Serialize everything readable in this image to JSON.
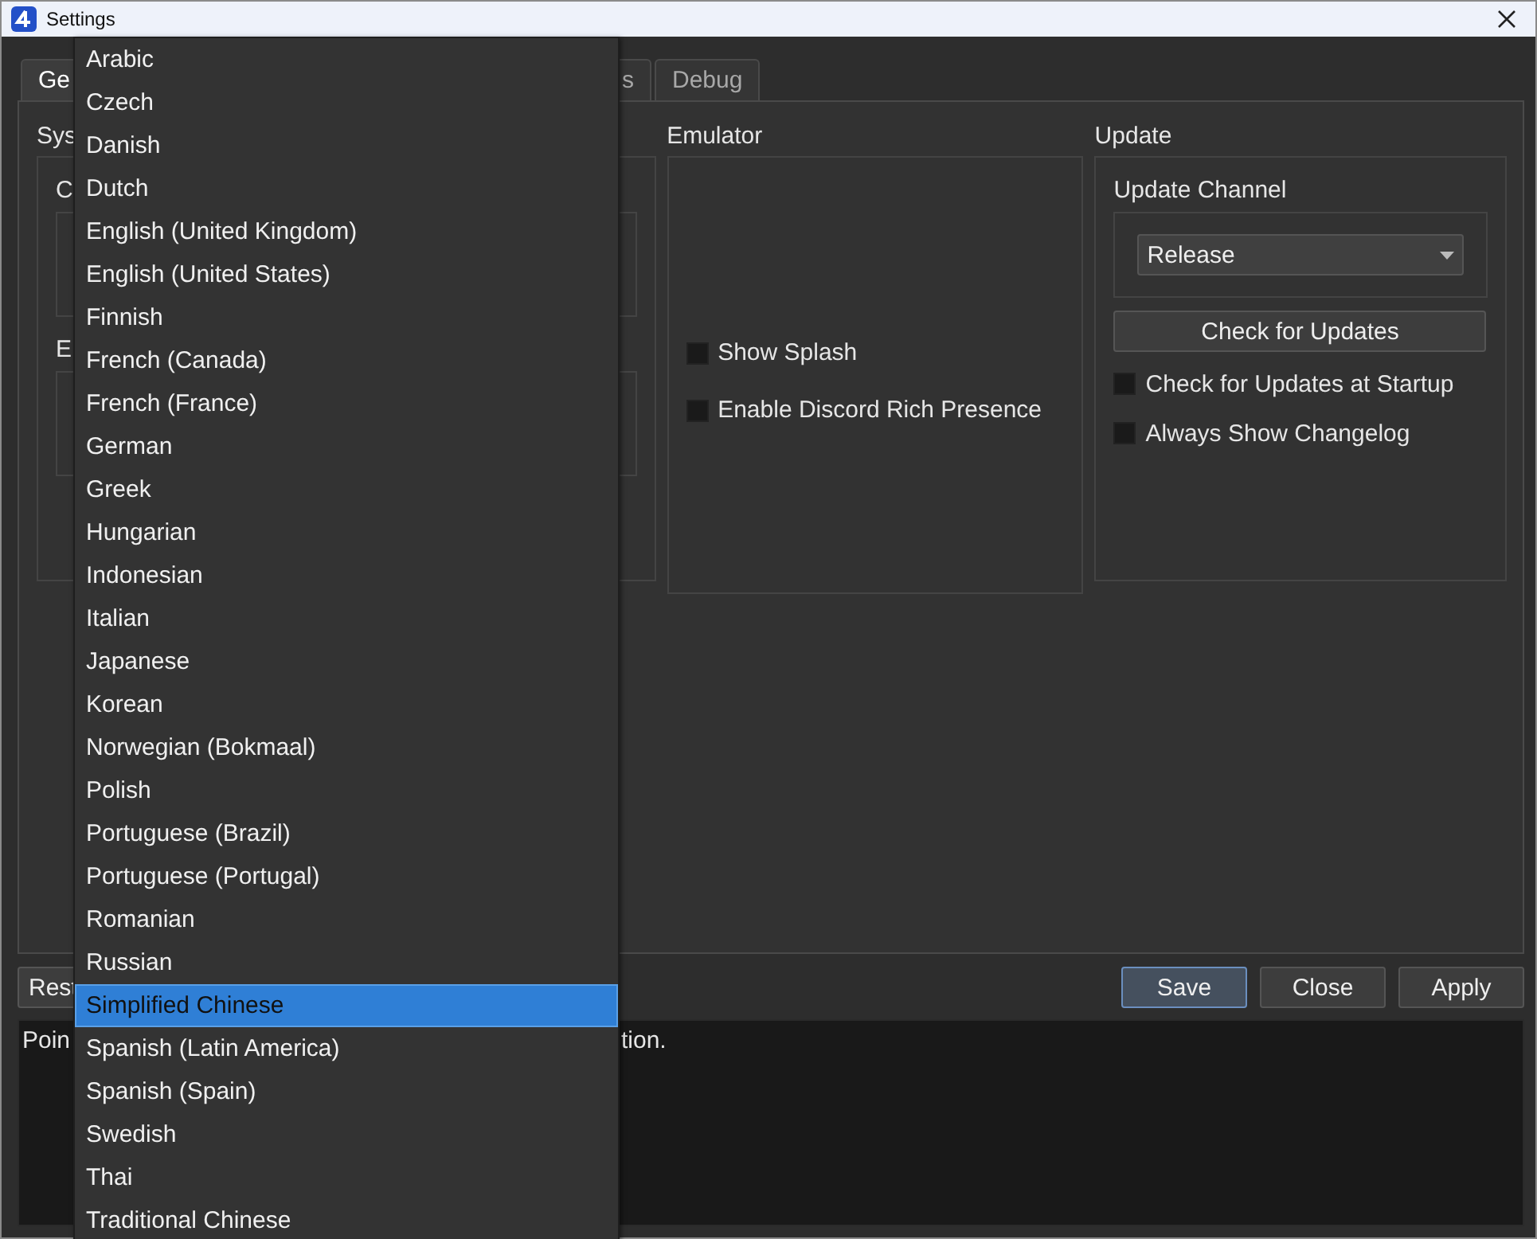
{
  "window": {
    "title": "Settings"
  },
  "tabs": [
    {
      "label": "Ge",
      "selected": true
    },
    {
      "label": "s",
      "selected": false
    },
    {
      "label": "Debug",
      "selected": false
    }
  ],
  "groups": [
    {
      "kind": "system",
      "title": "Sys",
      "subgroups": [
        {
          "title": "C"
        },
        {
          "title": "E"
        }
      ]
    },
    {
      "kind": "emulator",
      "title": "Emulator",
      "checkboxes": [
        {
          "label": "Show Splash",
          "checked": false
        },
        {
          "label": "Enable Discord Rich Presence",
          "checked": false
        }
      ]
    },
    {
      "kind": "update",
      "title": "Update",
      "channel_label": "Update Channel",
      "channel_value": "Release",
      "check_button": "Check for Updates",
      "checkboxes": [
        {
          "label": "Check for Updates at Startup",
          "checked": false
        },
        {
          "label": "Always Show Changelog",
          "checked": false
        }
      ]
    }
  ],
  "bottom": {
    "left_button": "Rest",
    "buttons": [
      {
        "label": "Save",
        "default": true
      },
      {
        "label": "Close",
        "default": false
      },
      {
        "label": "Apply",
        "default": false
      }
    ]
  },
  "log": {
    "start": "Poin",
    "end": "tion."
  },
  "language_menu": {
    "items": [
      {
        "label": "Arabic",
        "selected": false
      },
      {
        "label": "Czech",
        "selected": false
      },
      {
        "label": "Danish",
        "selected": false
      },
      {
        "label": "Dutch",
        "selected": false
      },
      {
        "label": "English (United Kingdom)",
        "selected": false
      },
      {
        "label": "English (United States)",
        "selected": false
      },
      {
        "label": "Finnish",
        "selected": false
      },
      {
        "label": "French (Canada)",
        "selected": false
      },
      {
        "label": "French (France)",
        "selected": false
      },
      {
        "label": "German",
        "selected": false
      },
      {
        "label": "Greek",
        "selected": false
      },
      {
        "label": "Hungarian",
        "selected": false
      },
      {
        "label": "Indonesian",
        "selected": false
      },
      {
        "label": "Italian",
        "selected": false
      },
      {
        "label": "Japanese",
        "selected": false
      },
      {
        "label": "Korean",
        "selected": false
      },
      {
        "label": "Norwegian (Bokmaal)",
        "selected": false
      },
      {
        "label": "Polish",
        "selected": false
      },
      {
        "label": "Portuguese (Brazil)",
        "selected": false
      },
      {
        "label": "Portuguese (Portugal)",
        "selected": false
      },
      {
        "label": "Romanian",
        "selected": false
      },
      {
        "label": "Russian",
        "selected": false
      },
      {
        "label": "Simplified Chinese",
        "selected": true
      },
      {
        "label": "Spanish (Latin America)",
        "selected": false
      },
      {
        "label": "Spanish (Spain)",
        "selected": false
      },
      {
        "label": "Swedish",
        "selected": false
      },
      {
        "label": "Thai",
        "selected": false
      },
      {
        "label": "Traditional Chinese",
        "selected": false
      }
    ]
  }
}
